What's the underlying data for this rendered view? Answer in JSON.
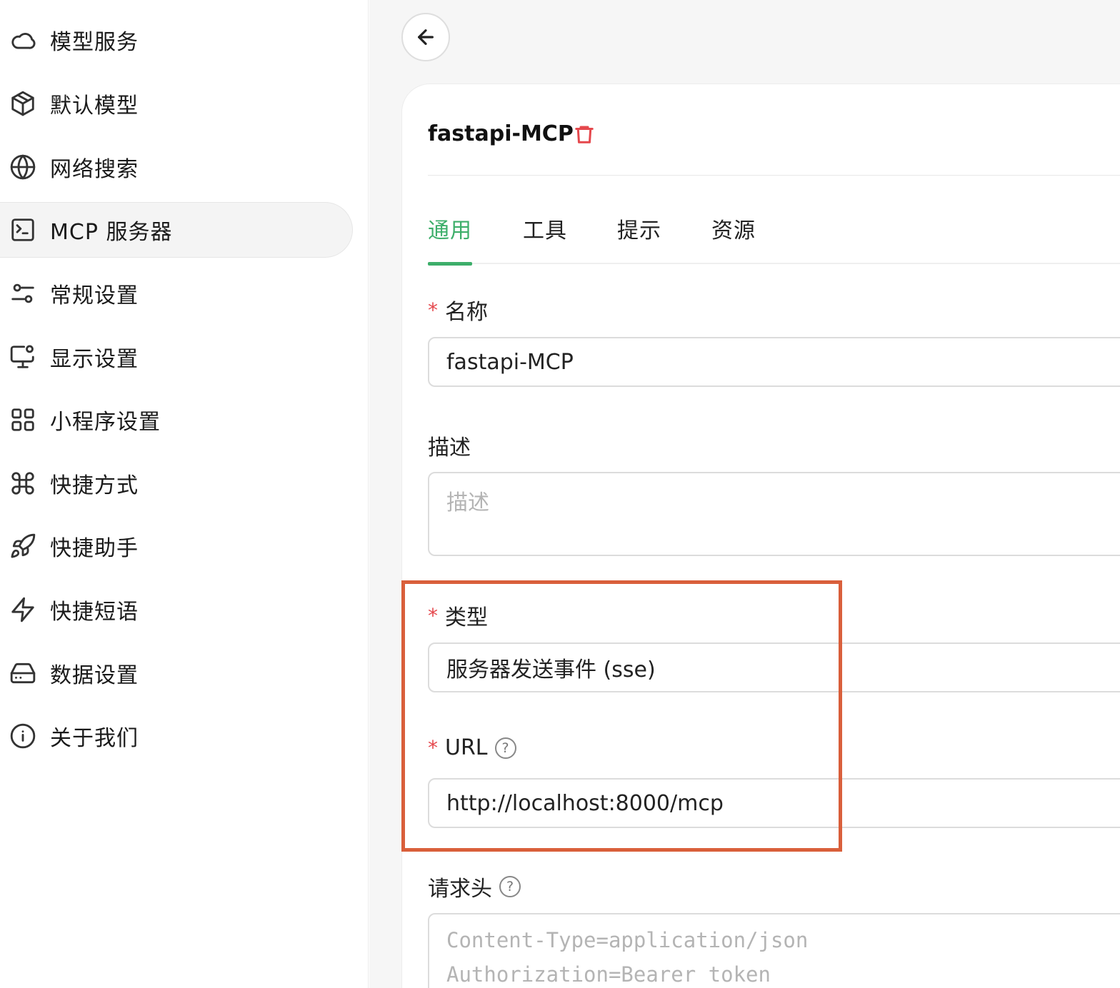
{
  "sidebar": {
    "items": [
      {
        "label": "模型服务",
        "icon": "cloud-icon"
      },
      {
        "label": "默认模型",
        "icon": "cube-icon"
      },
      {
        "label": "网络搜索",
        "icon": "globe-icon"
      },
      {
        "label": "MCP 服务器",
        "icon": "terminal-icon",
        "active": true
      },
      {
        "label": "常规设置",
        "icon": "sliders-icon"
      },
      {
        "label": "显示设置",
        "icon": "monitor-gear-icon"
      },
      {
        "label": "小程序设置",
        "icon": "grid-icon"
      },
      {
        "label": "快捷方式",
        "icon": "command-icon"
      },
      {
        "label": "快捷助手",
        "icon": "rocket-icon"
      },
      {
        "label": "快捷短语",
        "icon": "zap-icon"
      },
      {
        "label": "数据设置",
        "icon": "hard-drive-icon"
      },
      {
        "label": "关于我们",
        "icon": "info-icon"
      }
    ]
  },
  "server": {
    "title": "fastapi-MCP"
  },
  "tabs": [
    {
      "label": "通用",
      "active": true
    },
    {
      "label": "工具"
    },
    {
      "label": "提示"
    },
    {
      "label": "资源"
    }
  ],
  "form": {
    "required_mark": "*",
    "name": {
      "label": "名称",
      "value": "fastapi-MCP"
    },
    "description": {
      "label": "描述",
      "placeholder": "描述"
    },
    "type": {
      "label": "类型",
      "value": "服务器发送事件 (sse)"
    },
    "url": {
      "label": "URL",
      "value": "http://localhost:8000/mcp",
      "help": "?"
    },
    "headers": {
      "label": "请求头",
      "help": "?",
      "placeholder_line1": "Content-Type=application/json",
      "placeholder_line2": "Authorization=Bearer token"
    }
  },
  "colors": {
    "accent": "#3dae6a",
    "danger": "#e5484d",
    "highlight": "#d95f3b"
  }
}
